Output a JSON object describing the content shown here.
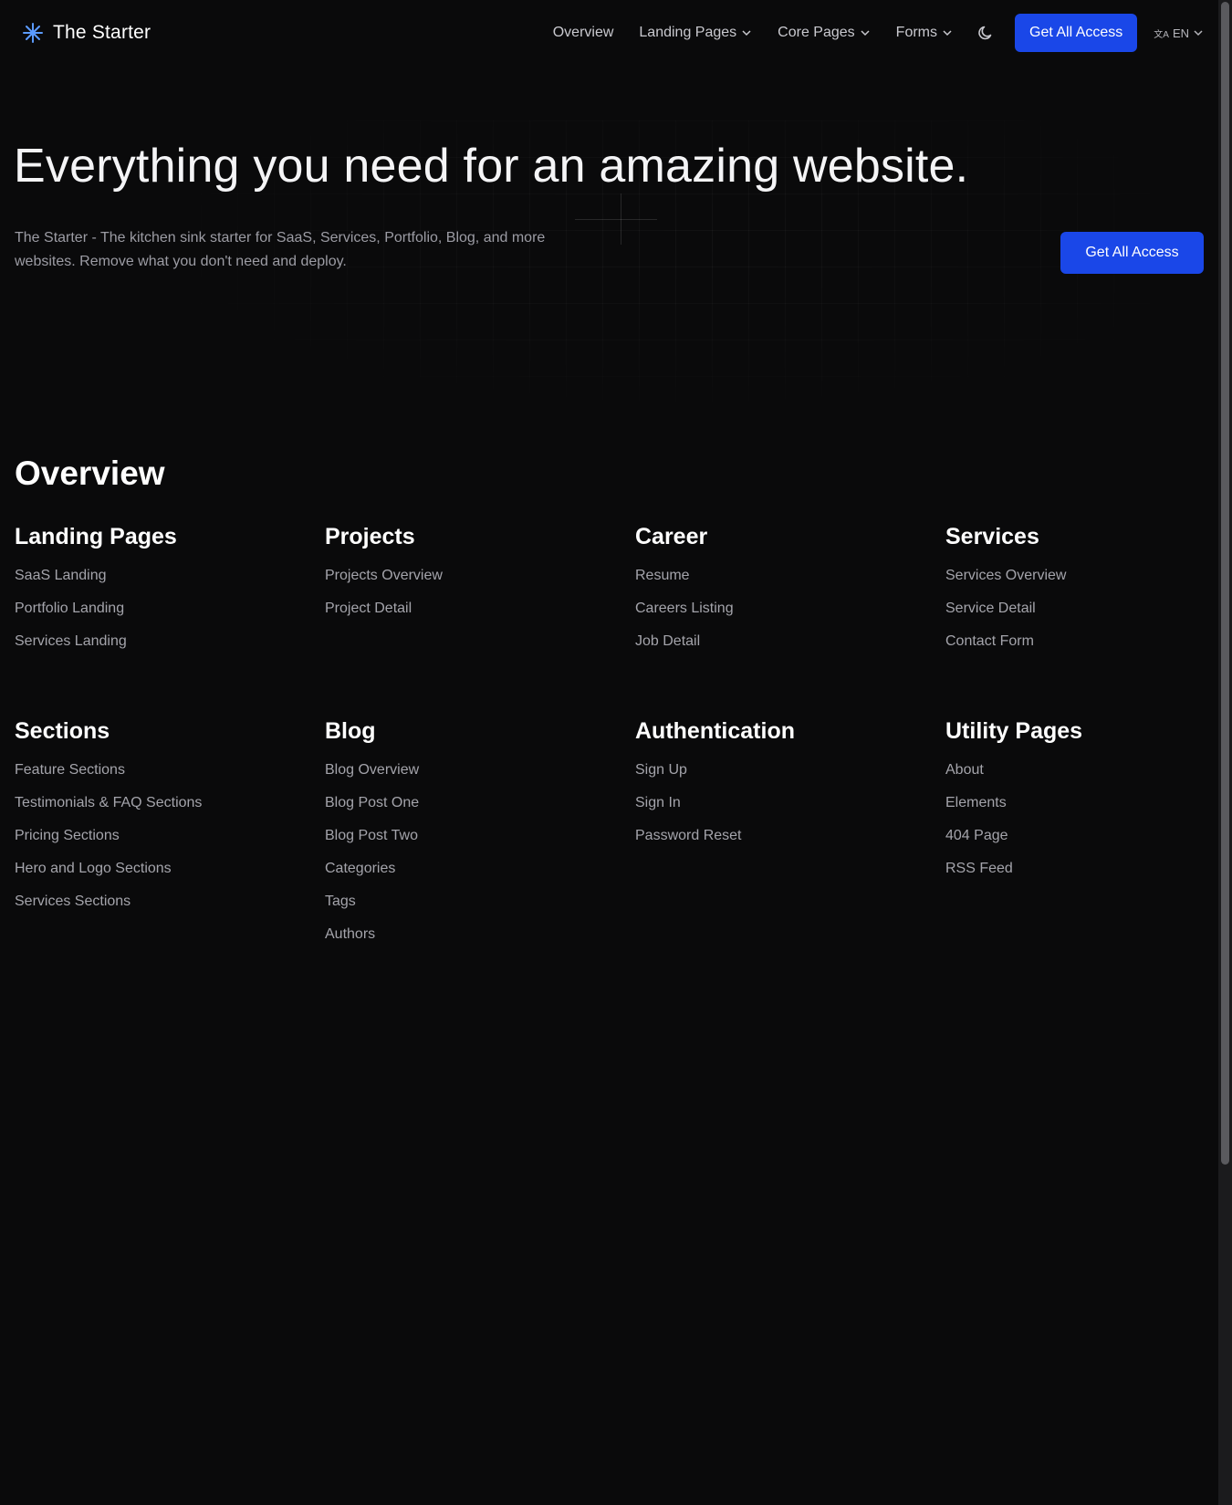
{
  "header": {
    "brand_name": "The Starter",
    "brand_icon": "sparkle-star-icon",
    "nav": [
      {
        "label": "Overview",
        "has_dropdown": false
      },
      {
        "label": "Landing Pages",
        "has_dropdown": true
      },
      {
        "label": "Core Pages",
        "has_dropdown": true
      },
      {
        "label": "Forms",
        "has_dropdown": true
      }
    ],
    "theme_icon": "moon-icon",
    "cta_label": "Get All Access",
    "language": "EN"
  },
  "hero": {
    "title": "Everything you need for an amazing website.",
    "description": "The Starter - The kitchen sink starter for SaaS, Services, Portfolio, Blog, and more websites. Remove what you don't need and deploy.",
    "cta_label": "Get All Access"
  },
  "overview": {
    "title": "Overview",
    "groups": [
      {
        "title": "Landing Pages",
        "links": [
          "SaaS Landing",
          "Portfolio Landing",
          "Services Landing"
        ]
      },
      {
        "title": "Projects",
        "links": [
          "Projects Overview",
          "Project Detail"
        ]
      },
      {
        "title": "Career",
        "links": [
          "Resume",
          "Careers Listing",
          "Job Detail"
        ]
      },
      {
        "title": "Services",
        "links": [
          "Services Overview",
          "Service Detail",
          "Contact Form"
        ]
      },
      {
        "title": "Sections",
        "links": [
          "Feature Sections",
          "Testimonials & FAQ Sections",
          "Pricing Sections",
          "Hero and Logo Sections",
          "Services Sections"
        ]
      },
      {
        "title": "Blog",
        "links": [
          "Blog Overview",
          "Blog Post One",
          "Blog Post Two",
          "Categories",
          "Tags",
          "Authors"
        ]
      },
      {
        "title": "Authentication",
        "links": [
          "Sign Up",
          "Sign In",
          "Password Reset"
        ]
      },
      {
        "title": "Utility Pages",
        "links": [
          "About",
          "Elements",
          "404 Page",
          "RSS Feed"
        ]
      }
    ]
  },
  "colors": {
    "background": "#0a0a0b",
    "accent": "#1a47e8",
    "brand_icon": "#5b9bff",
    "muted_text": "#a4a4ab"
  }
}
